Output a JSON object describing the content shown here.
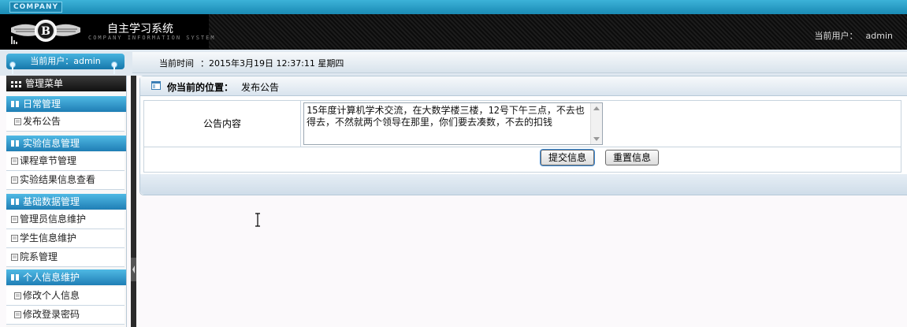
{
  "header": {
    "company": "COMPANY",
    "title": "自主学习系统",
    "subtitle": "COMPANY INFORMATION SYSTEM",
    "user_label": "当前用户：",
    "user_name": "admin"
  },
  "sidebar": {
    "current_user": "当前用户：admin",
    "menu_title": "管理菜单",
    "groups": [
      {
        "label": "日常管理",
        "items": [
          "发布公告"
        ]
      },
      {
        "label": "实验信息管理",
        "items": [
          "课程章节管理",
          "实验结果信息查看"
        ]
      },
      {
        "label": "基础数据管理",
        "items": [
          "管理员信息维护",
          "学生信息维护",
          "院系管理"
        ]
      },
      {
        "label": "个人信息维护",
        "items": [
          "修改个人信息",
          "修改登录密码"
        ]
      }
    ]
  },
  "time_bar": {
    "label": "当前时间",
    "value": "：2015年3月19日  12:37:11  星期四"
  },
  "main": {
    "location_label": "你当前的位置：",
    "location_value": "发布公告",
    "field_label": "公告内容",
    "field_value": "15年度计算机学术交流，在大数学楼三楼，12号下午三点，不去也得去，不然就两个领导在那里，你们要去凑数，不去的扣钱",
    "submit_label": "提交信息",
    "reset_label": "重置信息"
  },
  "colors": {
    "accent": "#2a8fc4",
    "header_bg": "#000000",
    "group_bg": "#2e95c8"
  }
}
